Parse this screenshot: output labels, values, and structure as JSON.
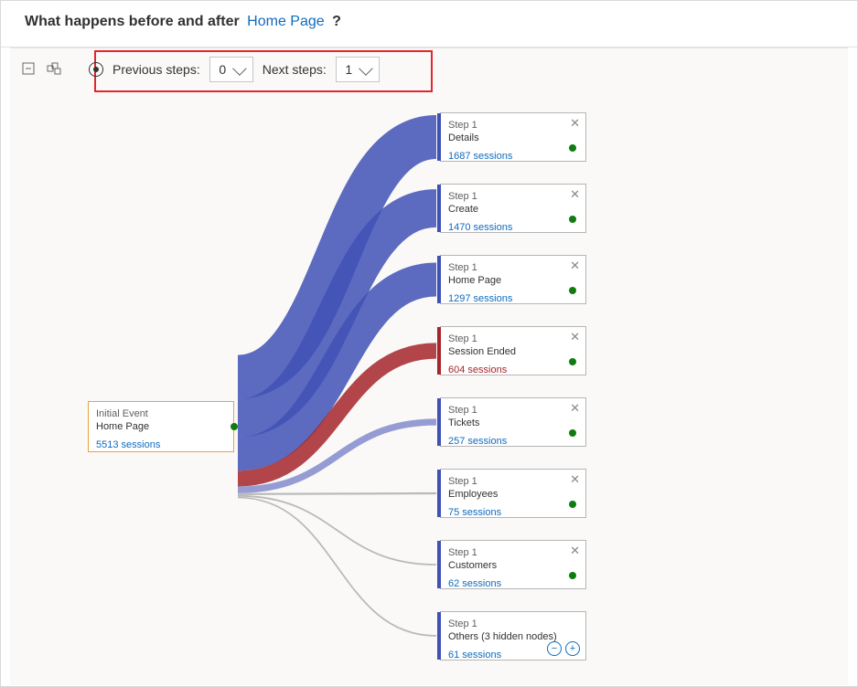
{
  "header": {
    "prefix": "What happens before and after",
    "event_name": "Home Page",
    "suffix": "?"
  },
  "toolbar": {
    "prev_label": "Previous steps:",
    "prev_value": "0",
    "next_label": "Next steps:",
    "next_value": "1"
  },
  "colors": {
    "link_primary": "#3f51b5",
    "link_red": "#a4262c",
    "link_gray": "#9e9e9e",
    "highlight": "#e3262d"
  },
  "initial": {
    "title": "Initial Event",
    "name": "Home Page",
    "sessions": "5513 sessions"
  },
  "nodes": [
    {
      "title": "Step 1",
      "name": "Details",
      "sessions": "1687 sessions",
      "kind": "blue"
    },
    {
      "title": "Step 1",
      "name": "Create",
      "sessions": "1470 sessions",
      "kind": "blue"
    },
    {
      "title": "Step 1",
      "name": "Home Page",
      "sessions": "1297 sessions",
      "kind": "blue"
    },
    {
      "title": "Step 1",
      "name": "Session Ended",
      "sessions": "604 sessions",
      "kind": "red"
    },
    {
      "title": "Step 1",
      "name": "Tickets",
      "sessions": "257 sessions",
      "kind": "blue"
    },
    {
      "title": "Step 1",
      "name": "Employees",
      "sessions": "75 sessions",
      "kind": "blue"
    },
    {
      "title": "Step 1",
      "name": "Customers",
      "sessions": "62 sessions",
      "kind": "blue"
    },
    {
      "title": "Step 1",
      "name": "Others (3 hidden nodes)",
      "sessions": "61 sessions",
      "kind": "others"
    }
  ]
}
